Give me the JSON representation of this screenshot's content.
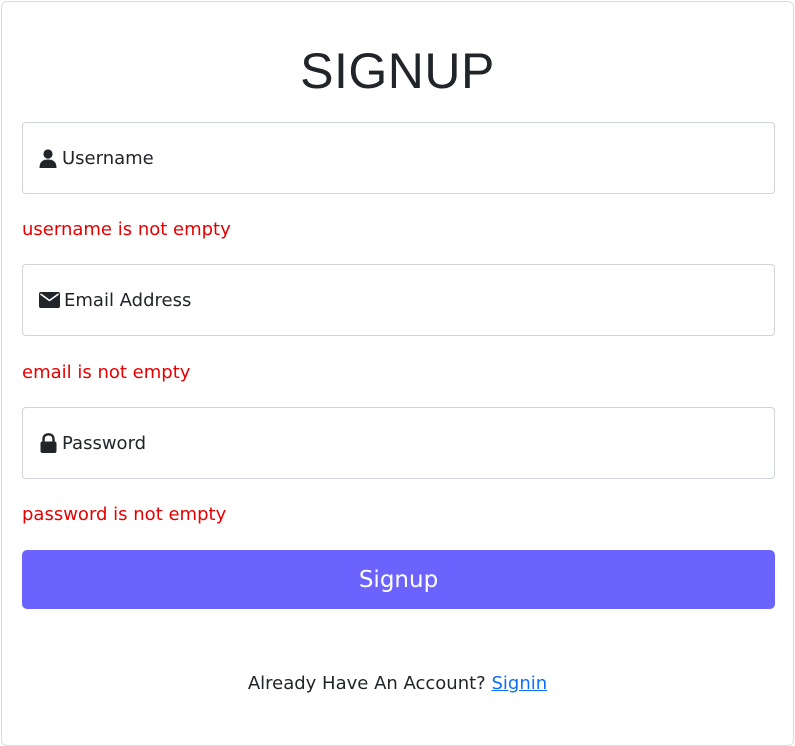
{
  "form": {
    "title": "SIGNUP",
    "fields": [
      {
        "icon": "user-icon",
        "placeholder": "Username",
        "error": "username is not empty"
      },
      {
        "icon": "envelope-icon",
        "placeholder": "Email Address",
        "error": "email is not empty"
      },
      {
        "icon": "lock-icon",
        "placeholder": "Password",
        "error": "password is not empty"
      }
    ],
    "submit_label": "Signup",
    "footer_text": "Already Have An Account?",
    "footer_link": "Signin"
  },
  "colors": {
    "button": "#6c63ff",
    "error": "#e60000",
    "link": "#0d6efd"
  }
}
